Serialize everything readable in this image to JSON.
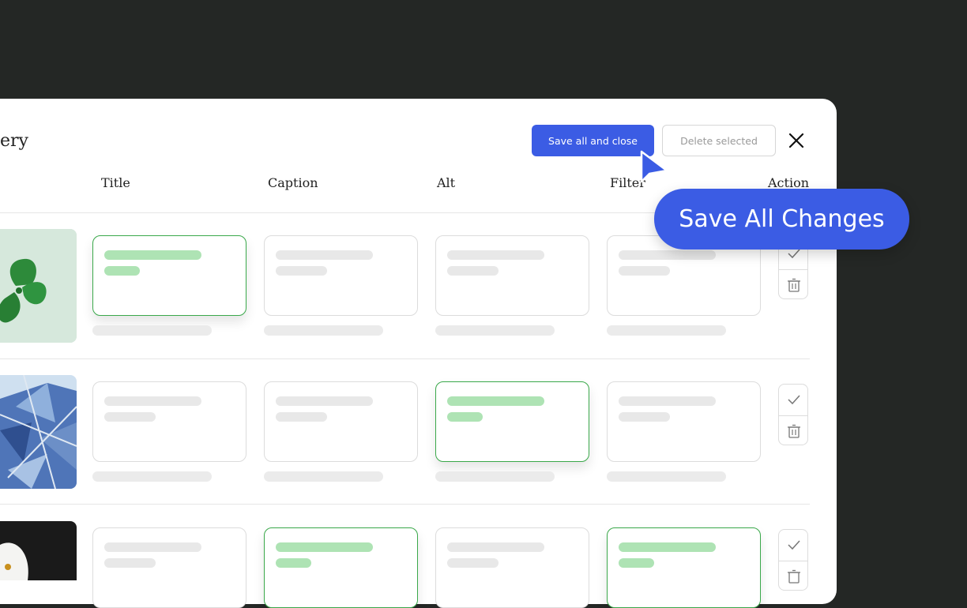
{
  "modal": {
    "title": "ery",
    "save_label": "Save all and close",
    "delete_label": "Delete selected",
    "close_icon": "close-icon"
  },
  "columns": [
    "Title",
    "Caption",
    "Alt",
    "Filter",
    "Action"
  ],
  "rows": [
    {
      "image": "clover-leaf",
      "active_fields": [
        "title"
      ]
    },
    {
      "image": "blue-geometric-building",
      "active_fields": [
        "alt"
      ]
    },
    {
      "image": "eagle-head",
      "active_fields": [
        "caption",
        "filter"
      ]
    }
  ],
  "actions": {
    "confirm_icon": "check-icon",
    "delete_icon": "trash-icon"
  },
  "tooltip": {
    "label": "Save All Changes"
  },
  "colors": {
    "primary": "#3b5ce4",
    "active_border": "#3aa84a",
    "active_bar": "#aee3b4",
    "background": "#242725"
  }
}
